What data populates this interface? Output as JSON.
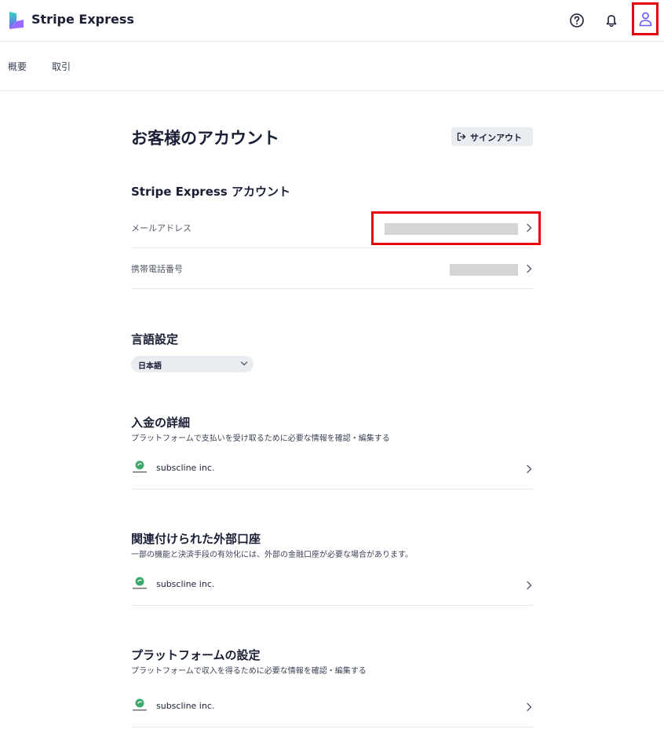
{
  "header": {
    "brand": "Stripe Express",
    "icons": [
      "help-icon",
      "bell-icon",
      "user-icon"
    ]
  },
  "nav": {
    "tabs": [
      {
        "label": "概要"
      },
      {
        "label": "取引"
      }
    ]
  },
  "page": {
    "title": "お客様のアカウント",
    "signout_label": "サインアウト"
  },
  "express_account": {
    "title": "Stripe Express アカウント",
    "rows": [
      {
        "label": "メールアドレス"
      },
      {
        "label": "携帯電話番号"
      }
    ]
  },
  "language": {
    "title": "言語設定",
    "selected": "日本語"
  },
  "payout": {
    "title": "入金の詳細",
    "description": "プラットフォームで支払いを受け取るために必要な情報を確認・編集する",
    "account": "subscline inc."
  },
  "external": {
    "title": "関連付けられた外部口座",
    "description": "一部の機能と決済手段の有効化には、外部の金融口座が必要な場合があります。",
    "account": "subscline inc."
  },
  "platform": {
    "title": "プラットフォームの設定",
    "description": "プラットフォームで収入を得るために必要な情報を確認・編集する",
    "account": "subscline inc."
  },
  "colors": {
    "accent": "#635bff",
    "highlight": "#e8000b"
  }
}
